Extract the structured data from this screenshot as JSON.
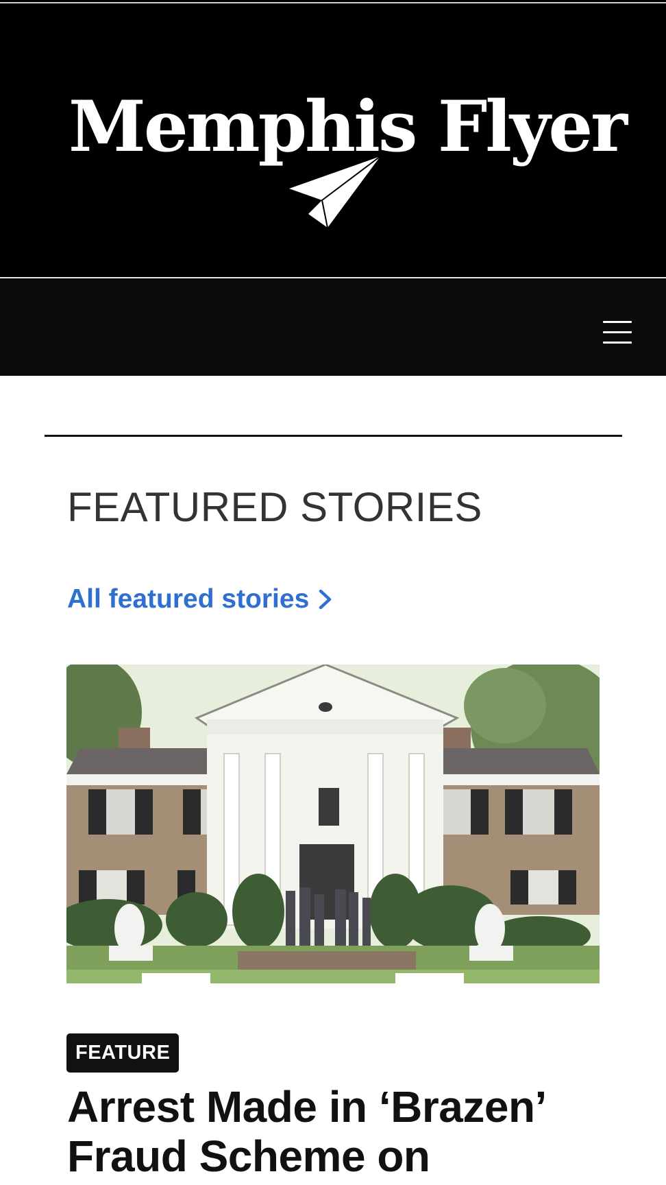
{
  "masthead": {
    "logo_text": "Memphis Flyer",
    "logo_icon": "paper-plane-icon"
  },
  "nav": {
    "menu_icon": "hamburger-menu-icon"
  },
  "featured": {
    "title": "FEATURED STORIES",
    "all_link_label": "All featured stories",
    "all_link_icon": "chevron-right-icon"
  },
  "story": {
    "badge": "FEATURE",
    "headline": "Arrest Made in ‘Brazen’ Fraud Scheme on"
  },
  "colors": {
    "link": "#2f6fd0",
    "masthead_bg": "#000000",
    "badge_bg": "#111111",
    "title_text": "#333333"
  }
}
